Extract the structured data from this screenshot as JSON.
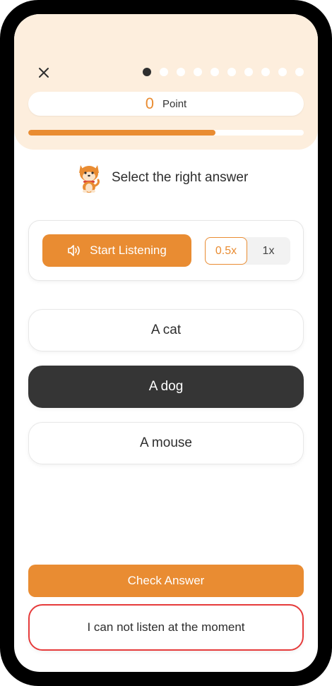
{
  "header": {
    "close_icon": "close-icon",
    "question_dots": {
      "total": 10,
      "current": 1
    },
    "points": {
      "value": "0",
      "label": "Point"
    },
    "progress": {
      "fraction": 0.68
    }
  },
  "prompt": {
    "mascot_icon": "shiba-dog-mascot-icon",
    "text": "Select the right answer"
  },
  "listening": {
    "speaker_icon": "speaker-icon",
    "start_label": "Start Listening",
    "speeds": [
      "0.5x",
      "1x"
    ],
    "selected_speed": "0.5x"
  },
  "options": [
    {
      "label": "A cat",
      "selected": false
    },
    {
      "label": "A dog",
      "selected": true
    },
    {
      "label": "A mouse",
      "selected": false
    }
  ],
  "footer": {
    "check_label": "Check Answer",
    "skip_label": "I can not listen at the moment"
  },
  "colors": {
    "accent": "#e98c32",
    "header_bg": "#fdeedd",
    "selected_bg": "#353535",
    "danger": "#e63b3b"
  }
}
